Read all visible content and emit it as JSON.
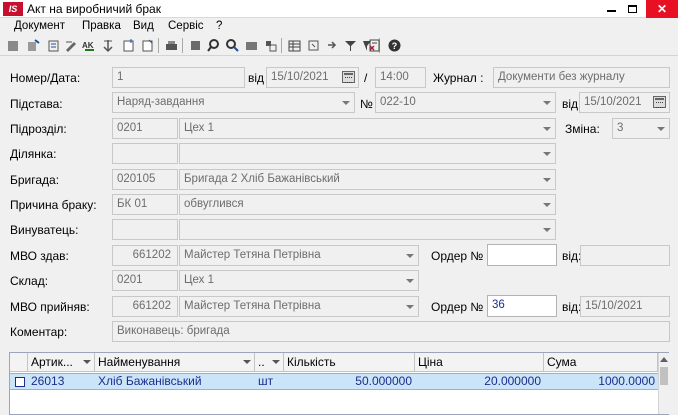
{
  "window": {
    "logo_text": "IS",
    "title": "Акт на виробничий брак"
  },
  "menu": [
    "Документ",
    "Правка",
    "Вид",
    "Сервіс",
    "?"
  ],
  "toolbar_icons": [
    "new-doc-icon",
    "copy-doc-icon",
    "insert-icon",
    "edit-icon",
    "sort-az-icon",
    "move-icon",
    "page-add-icon",
    "page-icon",
    "print-icon",
    "delete-icon",
    "find-icon",
    "find-next-icon",
    "filter-off-icon",
    "pin-icon",
    "table-icon",
    "refresh-icon",
    "export-icon",
    "filter-icon",
    "filter-clear-icon",
    "calculator-icon",
    "help-icon"
  ],
  "form": {
    "number_date": {
      "label": "Номер/Дата:",
      "number": "1",
      "from_label": "від",
      "date": "15/10/2021",
      "slash": "/",
      "time": "14:00",
      "journal_label": "Журнал :",
      "journal": "Документи без журналу"
    },
    "basis": {
      "label": "Підстава:",
      "value": "Наряд-завдання",
      "no_label": "№",
      "no": "022-10",
      "from_label": "від",
      "date": "15/10/2021"
    },
    "division": {
      "label": "Підрозділ:",
      "code": "0201",
      "name": "Цех 1",
      "shift_label": "Зміна:",
      "shift": "3"
    },
    "section": {
      "label": "Ділянка:",
      "code": "",
      "name": ""
    },
    "brigade": {
      "label": "Бригада:",
      "code": "020105",
      "name": "Бригада 2 Хліб Бажанівський"
    },
    "defect_reason": {
      "label": "Причина браку:",
      "code": "БК 01",
      "name": "обвуглився"
    },
    "culprit": {
      "label": "Винуватець:",
      "code": "",
      "name": ""
    },
    "mvo_out": {
      "label": "МВО здав:",
      "code": "661202",
      "name": "Майстер Тетяна Петрівна",
      "order_label": "Ордер №",
      "order": "",
      "from_label": "від:",
      "date": ""
    },
    "warehouse": {
      "label": "Склад:",
      "code": "0201",
      "name": "Цех 1"
    },
    "mvo_in": {
      "label": "МВО прийняв:",
      "code": "661202",
      "name": "Майстер Тетяна Петрівна",
      "order_label": "Ордер №",
      "order": "36",
      "from_label": "від:",
      "date": "15/10/2021"
    },
    "comment": {
      "label": "Коментар:",
      "value": "Виконавець: бригада"
    }
  },
  "grid": {
    "columns": [
      "Артик...",
      "Найменування",
      "..",
      "Кількість",
      "Ціна",
      "Сума"
    ],
    "rows": [
      {
        "article": "26013",
        "name": "Хліб Бажанівський",
        "unit": "шт",
        "qty": "50.000000",
        "price": "20.000000",
        "sum": "1000.0000"
      }
    ]
  }
}
